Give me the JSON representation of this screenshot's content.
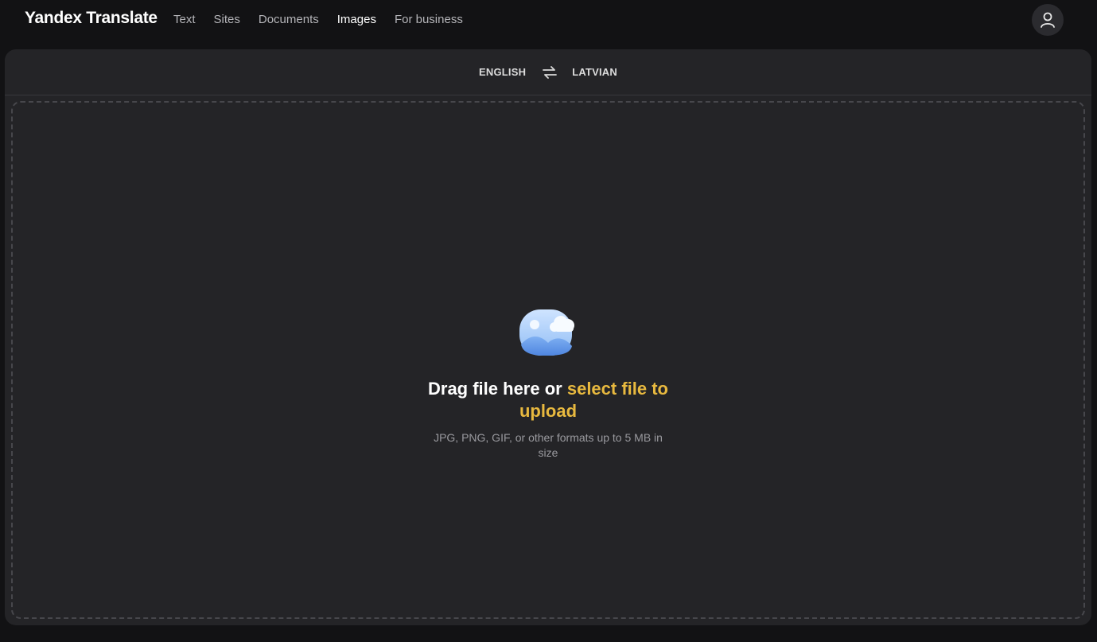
{
  "header": {
    "brand": "Yandex Translate",
    "nav": [
      {
        "label": "Text",
        "active": false
      },
      {
        "label": "Sites",
        "active": false
      },
      {
        "label": "Documents",
        "active": false
      },
      {
        "label": "Images",
        "active": true
      },
      {
        "label": "For business",
        "active": false
      }
    ],
    "avatar_icon": "user-icon"
  },
  "languages": {
    "source": "ENGLISH",
    "target": "LATVIAN",
    "swap_icon": "swap-arrows-icon"
  },
  "dropzone": {
    "icon": "image-upload-icon",
    "title_prefix": "Drag file here or ",
    "title_link": "select file to upload",
    "hint": "JPG, PNG, GIF, or other formats up to 5 MB in size"
  },
  "colors": {
    "background": "#121214",
    "panel": "#242427",
    "accent_link": "#e8b93f",
    "hint_text": "#9a9a9f"
  }
}
